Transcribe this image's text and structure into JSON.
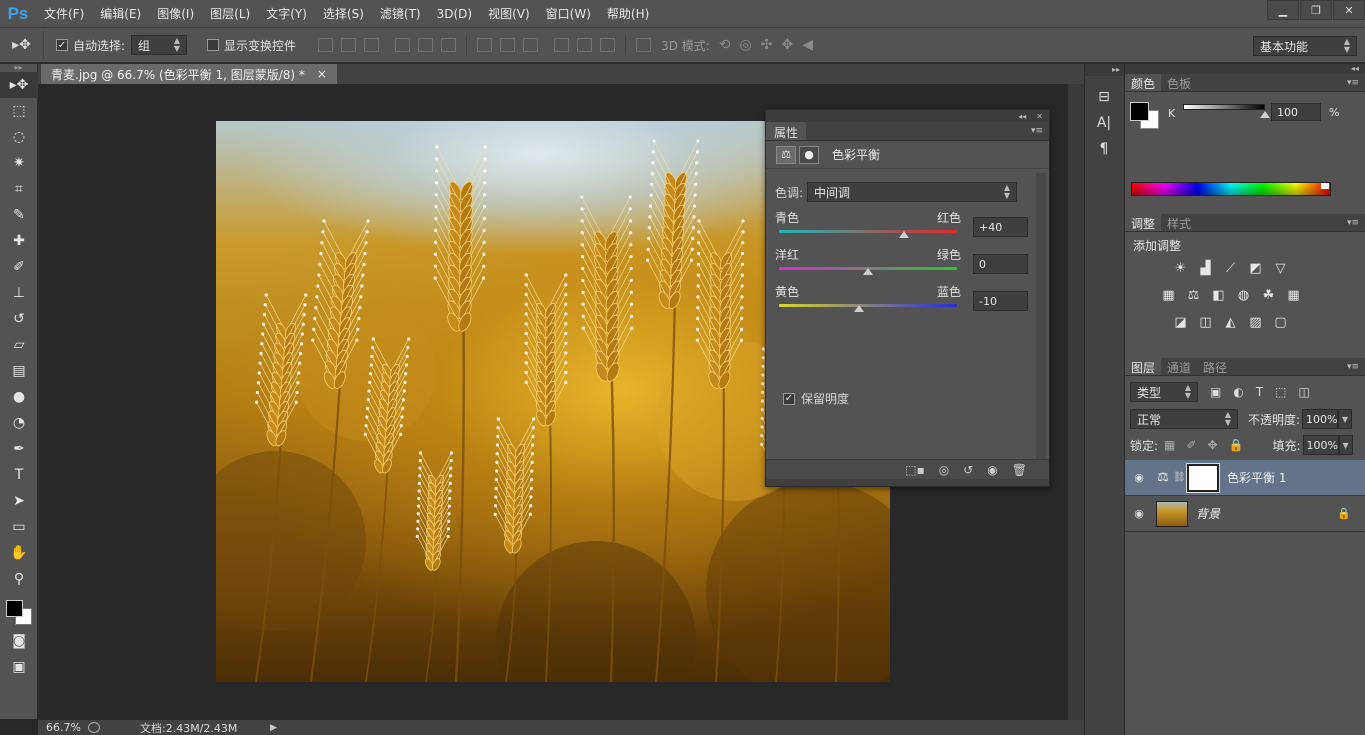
{
  "app": {
    "logo": "Ps"
  },
  "menu": [
    "文件(F)",
    "编辑(E)",
    "图像(I)",
    "图层(L)",
    "文字(Y)",
    "选择(S)",
    "滤镜(T)",
    "3D(D)",
    "视图(V)",
    "窗口(W)",
    "帮助(H)"
  ],
  "window_controls": {
    "minimize": "▁",
    "restore": "❐",
    "close": "✕"
  },
  "options": {
    "auto_select_label": "自动选择:",
    "auto_select_checked": true,
    "auto_select_value": "组",
    "show_transform_label": "显示变换控件",
    "show_transform_checked": false,
    "mode3d_label": "3D 模式:",
    "workspace": "基本功能"
  },
  "document": {
    "tab_title": "青麦.jpg @ 66.7% (色彩平衡 1, 图层蒙版/8) *",
    "tab_close": "×",
    "zoom": "66.7%",
    "doc_info": "文档:2.43M/2.43M"
  },
  "properties": {
    "tab": "属性",
    "title": "色彩平衡",
    "tone_label": "色调:",
    "tone_value": "中间调",
    "sliders": [
      {
        "left": "青色",
        "right": "红色",
        "value": "+40",
        "numeric": 40
      },
      {
        "left": "洋红",
        "right": "绿色",
        "value": "0",
        "numeric": 0
      },
      {
        "left": "黄色",
        "right": "蓝色",
        "value": "-10",
        "numeric": -10
      }
    ],
    "preserve_label": "保留明度",
    "preserve_checked": true
  },
  "color_panel": {
    "tabs": [
      "颜色",
      "色板"
    ],
    "channel": "K",
    "value": "100",
    "unit": "%",
    "level": 1.0
  },
  "adjustments_panel": {
    "tabs": [
      "调整",
      "样式"
    ],
    "title": "添加调整"
  },
  "layers_panel": {
    "tabs": [
      "图层",
      "通道",
      "路径"
    ],
    "filter": "类型",
    "blend_mode": "正常",
    "opacity_label": "不透明度:",
    "opacity": "100%",
    "lock_label": "锁定:",
    "fill_label": "填充:",
    "fill": "100%",
    "layers": [
      {
        "name": "色彩平衡 1",
        "type": "adjustment",
        "selected": true
      },
      {
        "name": "背景",
        "type": "image",
        "locked": true
      }
    ]
  },
  "colors": {
    "selected_layer": "#63748a",
    "ps_blue": "#3aa3ec"
  }
}
